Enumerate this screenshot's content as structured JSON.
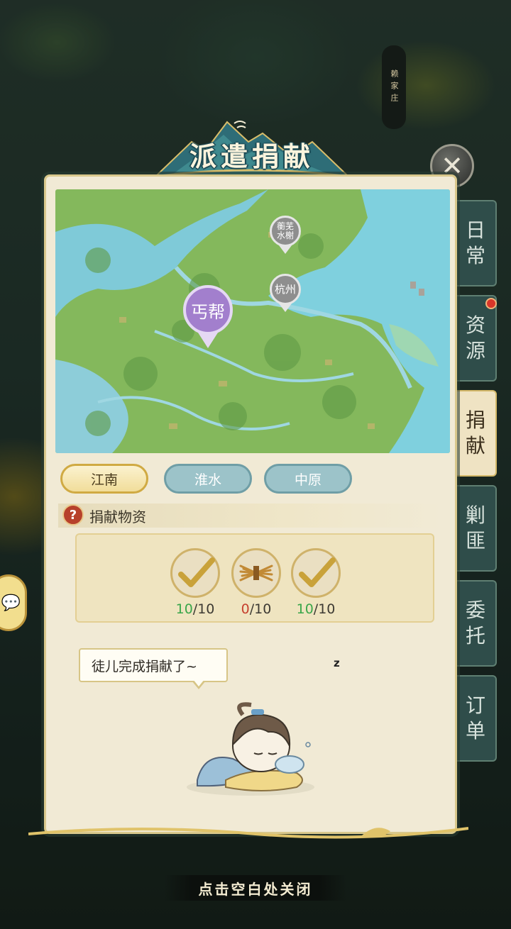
{
  "title": "派遣捐献",
  "close_icon": "close-x-icon",
  "village_label": "赖家庄",
  "map": {
    "pins": [
      {
        "label": "蘅芜\n水榭",
        "style": "gray"
      },
      {
        "label": "杭州",
        "style": "gray"
      },
      {
        "label": "丐帮",
        "style": "purple"
      }
    ]
  },
  "region_tabs": [
    {
      "label": "江南",
      "active": true
    },
    {
      "label": "淮水",
      "active": false
    },
    {
      "label": "中原",
      "active": false
    }
  ],
  "section": {
    "help_icon": "question-icon",
    "title": "捐献物资"
  },
  "items": [
    {
      "icon": "checkmark-icon",
      "have": "10",
      "need": "/10",
      "status": "complete"
    },
    {
      "icon": "straw-bundle-icon",
      "have": "0",
      "need": "/10",
      "status": "lacking"
    },
    {
      "icon": "checkmark-icon",
      "have": "10",
      "need": "/10",
      "status": "complete"
    }
  ],
  "speech_bubble": "徒儿完成捐献了~",
  "zzz": "z",
  "side_tabs": [
    {
      "label": "日常",
      "active": false,
      "badge": false
    },
    {
      "label": "资源",
      "active": false,
      "badge": true
    },
    {
      "label": "捐献",
      "active": true,
      "badge": false
    },
    {
      "label": "剿匪",
      "active": false,
      "badge": false
    },
    {
      "label": "委托",
      "active": false,
      "badge": false
    },
    {
      "label": "订单",
      "active": false,
      "badge": false
    }
  ],
  "footer": "点击空白处关闭",
  "colors": {
    "active_tab": "#f1dd9a",
    "inactive_tab": "#9cc3c9",
    "panel": "#f1ead5",
    "progress_ok": "#3aa64a",
    "progress_lacking": "#c6402e"
  }
}
